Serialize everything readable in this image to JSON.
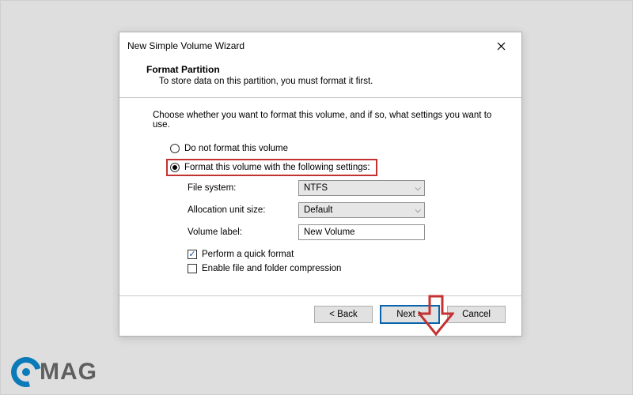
{
  "window": {
    "title": "New Simple Volume Wizard"
  },
  "header": {
    "heading": "Format Partition",
    "subheading": "To store data on this partition, you must format it first."
  },
  "content": {
    "intro": "Choose whether you want to format this volume, and if so, what settings you want to use.",
    "option_no_format": "Do not format this volume",
    "option_format": "Format this volume with the following settings:",
    "filesystem_label": "File system:",
    "filesystem_value": "NTFS",
    "allocation_label": "Allocation unit size:",
    "allocation_value": "Default",
    "volume_label_label": "Volume label:",
    "volume_label_value": "New Volume",
    "quick_format": "Perform a quick format",
    "compression": "Enable file and folder compression"
  },
  "footer": {
    "back": "< Back",
    "next": "Next >",
    "cancel": "Cancel"
  },
  "watermark": {
    "text": "MAG"
  }
}
